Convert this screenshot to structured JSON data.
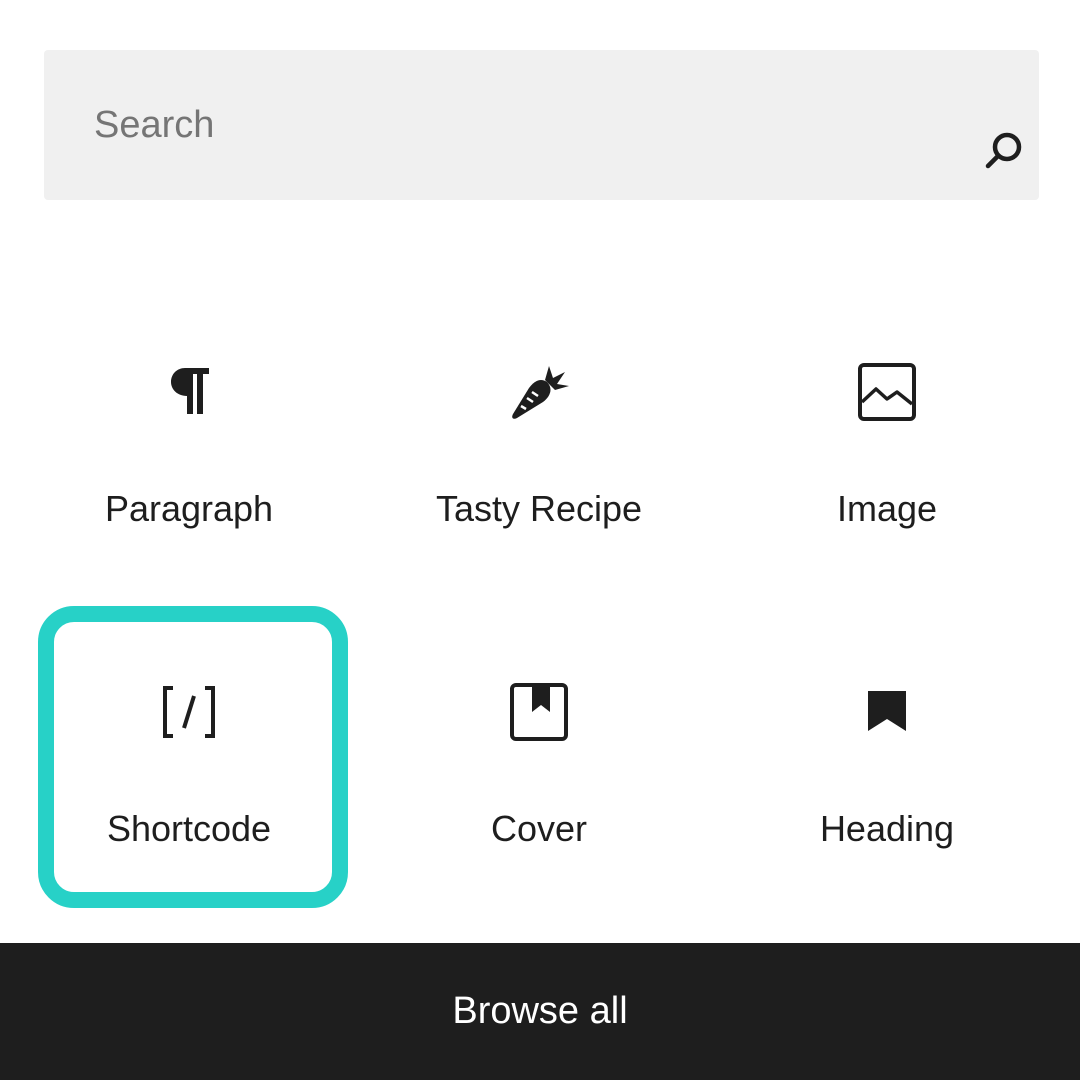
{
  "search": {
    "placeholder": "Search",
    "value": "",
    "icon": "search-icon"
  },
  "blocks": [
    {
      "label": "Paragraph",
      "icon": "paragraph-icon"
    },
    {
      "label": "Tasty Recipe",
      "icon": "carrot-icon"
    },
    {
      "label": "Image",
      "icon": "image-icon"
    },
    {
      "label": "Shortcode",
      "icon": "shortcode-icon",
      "highlighted": true
    },
    {
      "label": "Cover",
      "icon": "cover-icon"
    },
    {
      "label": "Heading",
      "icon": "bookmark-icon"
    }
  ],
  "footer": {
    "label": "Browse all"
  },
  "colors": {
    "highlight": "#27d1c7",
    "footer_bg": "#1e1e1e",
    "search_bg": "#f0f0f0",
    "text": "#1e1e1e",
    "placeholder": "#757575"
  }
}
